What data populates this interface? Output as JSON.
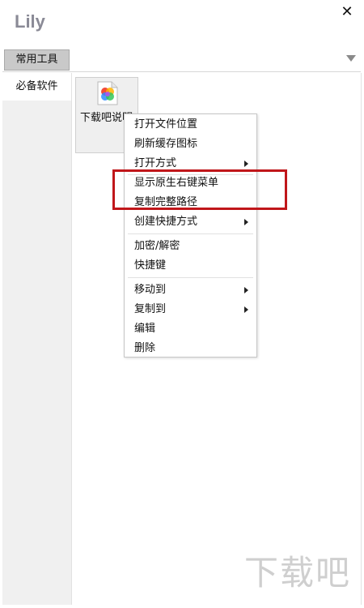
{
  "window": {
    "title": "Lily",
    "close_symbol": "✕"
  },
  "tabs": [
    {
      "label": "常用工具"
    }
  ],
  "sidebar": {
    "items": [
      {
        "label": "必备软件"
      }
    ]
  },
  "file": {
    "label": "下载吧说明"
  },
  "context_menu": {
    "items": [
      {
        "label": "打开文件位置",
        "has_submenu": false
      },
      {
        "label": "刷新缓存图标",
        "has_submenu": false
      },
      {
        "label": "打开方式",
        "has_submenu": true
      },
      {
        "label": "显示原生右键菜单",
        "has_submenu": false
      },
      {
        "label": "复制完整路径",
        "has_submenu": false
      },
      {
        "label": "创建快捷方式",
        "has_submenu": true
      },
      {
        "label": "加密/解密",
        "has_submenu": false
      },
      {
        "label": "快捷键",
        "has_submenu": false
      },
      {
        "label": "移动到",
        "has_submenu": true
      },
      {
        "label": "复制到",
        "has_submenu": true
      },
      {
        "label": "编辑",
        "has_submenu": false
      },
      {
        "label": "删除",
        "has_submenu": false
      }
    ]
  },
  "annotation": {
    "highlight_color": "#c0161a"
  },
  "watermark": {
    "text": "下载吧"
  }
}
